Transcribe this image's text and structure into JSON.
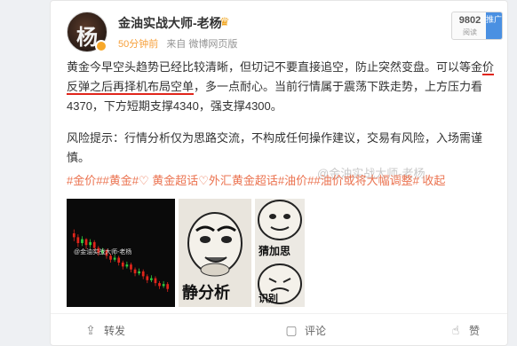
{
  "user": {
    "name": "金油实战大师-老杨",
    "avatar_text": "杨",
    "crown_icon": "crown-icon",
    "time": "50分钟前",
    "source_prefix": "来自",
    "source": "微博网页版"
  },
  "read_badge": {
    "count": "9802",
    "label": "阅读",
    "promote": "推广"
  },
  "post": {
    "p1_a": "黄金今早空头趋势已经比较清晰，但切记不要直接追空，防止突然变盘。可以等金",
    "p1_b": "价反弹之后再择机布局空单",
    "p1_c": "，多一点耐心。当前行情属于震荡下跌走势，上方压力看4370，下方短期支撑4340，强支撑4300。",
    "p2": "风险提示：行情分析仅为思路交流，不构成任何操作建议，交易有风险，入场需谨慎。"
  },
  "tags": [
    "#金价#",
    "#黄金#",
    "♡ 黄金超话♡",
    "外汇黄金超话",
    "#油价#",
    "#油价或将大幅调整#",
    " 收起"
  ],
  "watermark": "@金油实战大师-老杨",
  "images": {
    "img1_caption": "@金油实战大师-老杨",
    "img2_caption": "静分析",
    "img3_caption_top": "猜加思",
    "img3_caption_bottom": "识别"
  },
  "chart_data": {
    "type": "candlestick",
    "note": "mini price chart thumbnail, downtrend",
    "candles": [
      [
        0.3,
        0.34,
        0.26,
        0.38
      ],
      [
        0.34,
        0.4,
        0.31,
        0.44
      ],
      [
        0.4,
        0.36,
        0.33,
        0.43
      ],
      [
        0.36,
        0.42,
        0.35,
        0.46
      ],
      [
        0.42,
        0.39,
        0.36,
        0.45
      ],
      [
        0.39,
        0.45,
        0.37,
        0.48
      ],
      [
        0.45,
        0.5,
        0.43,
        0.53
      ],
      [
        0.5,
        0.47,
        0.45,
        0.52
      ],
      [
        0.47,
        0.53,
        0.46,
        0.56
      ],
      [
        0.53,
        0.57,
        0.51,
        0.6
      ],
      [
        0.57,
        0.55,
        0.52,
        0.59
      ],
      [
        0.55,
        0.6,
        0.53,
        0.63
      ],
      [
        0.6,
        0.64,
        0.58,
        0.67
      ],
      [
        0.64,
        0.62,
        0.59,
        0.66
      ],
      [
        0.62,
        0.67,
        0.6,
        0.7
      ],
      [
        0.67,
        0.71,
        0.65,
        0.74
      ],
      [
        0.71,
        0.69,
        0.66,
        0.73
      ],
      [
        0.69,
        0.74,
        0.67,
        0.77
      ],
      [
        0.74,
        0.78,
        0.72,
        0.81
      ],
      [
        0.78,
        0.76,
        0.73,
        0.8
      ],
      [
        0.76,
        0.81,
        0.74,
        0.84
      ],
      [
        0.81,
        0.84,
        0.79,
        0.87
      ],
      [
        0.84,
        0.82,
        0.79,
        0.86
      ],
      [
        0.82,
        0.87,
        0.8,
        0.9
      ]
    ]
  },
  "actions": {
    "repost": "转发",
    "comment": "评论",
    "like": "赞"
  },
  "colors": {
    "time": "#f7a03b",
    "tags": "#eb7350",
    "underline": "#e0251b",
    "promote_bg": "#4a90e2"
  }
}
